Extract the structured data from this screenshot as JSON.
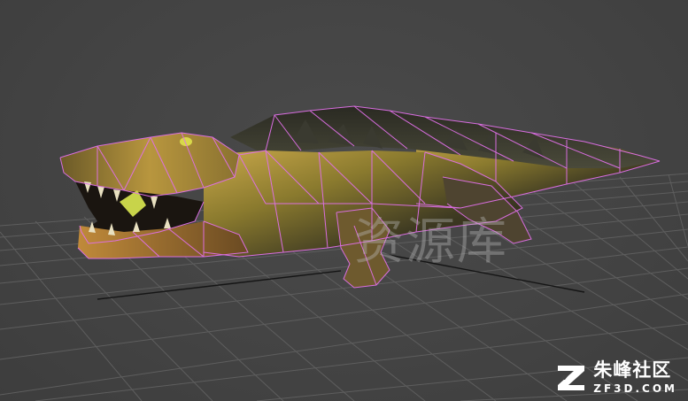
{
  "viewport": {
    "background_color": "#444444",
    "grid_color": "#5e5e5e",
    "axis_color": "#111111",
    "wire_color": "#e070e8"
  },
  "model": {
    "subject": "crocodile",
    "display_mode": "smooth-shaded + wireframe edges"
  },
  "watermark": {
    "text": "资源库"
  },
  "logo": {
    "icon": "zf-logo-icon",
    "name_cn": "朱峰社区",
    "name_en": "ZF3D.COM"
  }
}
